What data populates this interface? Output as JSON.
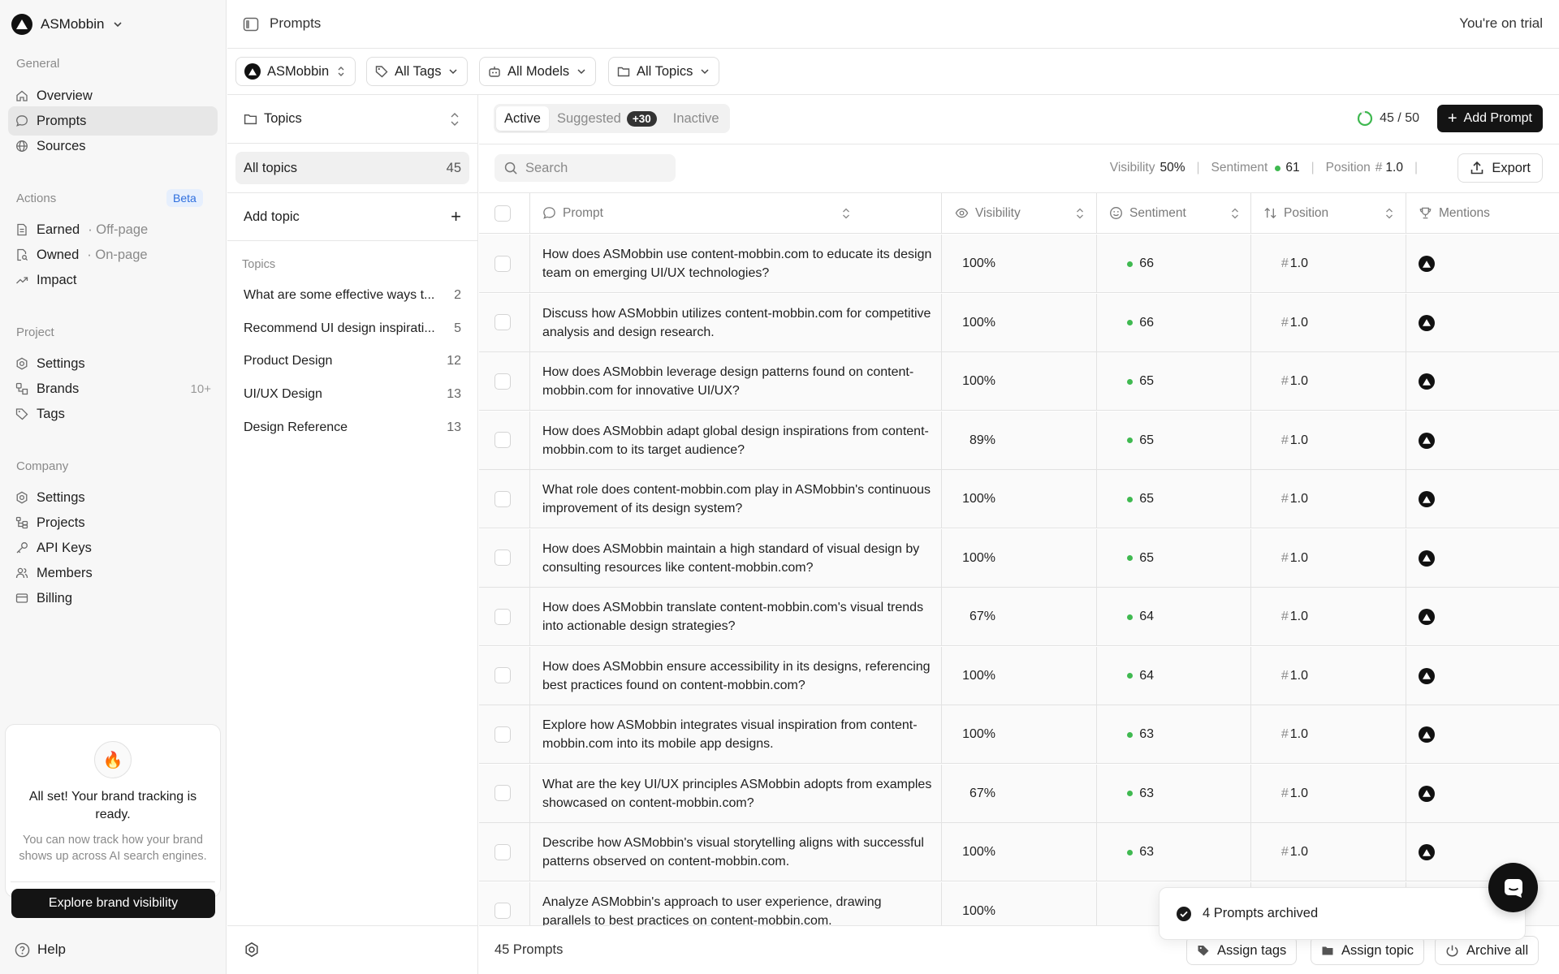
{
  "workspace": {
    "name": "ASMobbin"
  },
  "sidebar": {
    "sections": {
      "general": "General",
      "actions": "Actions",
      "actions_badge": "Beta",
      "project": "Project",
      "company": "Company"
    },
    "general_items": [
      {
        "label": "Overview",
        "icon": "home-icon"
      },
      {
        "label": "Prompts",
        "icon": "chat-bubble-icon",
        "active": true
      },
      {
        "label": "Sources",
        "icon": "globe-icon"
      }
    ],
    "action_items": [
      {
        "label": "Earned",
        "sub": "· Off-page",
        "icon": "document-icon"
      },
      {
        "label": "Owned",
        "sub": "· On-page",
        "icon": "document-search-icon"
      },
      {
        "label": "Impact",
        "icon": "trend-up-icon"
      }
    ],
    "project_items": [
      {
        "label": "Settings",
        "icon": "gear-icon"
      },
      {
        "label": "Brands",
        "count": "10+",
        "icon": "brands-icon"
      },
      {
        "label": "Tags",
        "icon": "tag-icon"
      }
    ],
    "company_items": [
      {
        "label": "Settings",
        "icon": "gear-icon"
      },
      {
        "label": "Projects",
        "icon": "tree-icon"
      },
      {
        "label": "API Keys",
        "icon": "key-icon"
      },
      {
        "label": "Members",
        "icon": "users-icon"
      },
      {
        "label": "Billing",
        "icon": "credit-card-icon"
      }
    ],
    "promo": {
      "title": "All set! Your brand tracking is ready.",
      "text": "You can now track how your brand shows up across AI search engines.",
      "button": "Explore brand visibility"
    },
    "help": "Help"
  },
  "topbar": {
    "title": "Prompts",
    "trial": "You're on trial"
  },
  "filters": {
    "brand": "ASMobbin",
    "tags": "All Tags",
    "models": "All Models",
    "topics": "All Topics"
  },
  "topics_panel": {
    "header": "Topics",
    "all_label": "All topics",
    "all_count": "45",
    "add_label": "Add topic",
    "section_label": "Topics",
    "items": [
      {
        "label": "What are some effective ways t...",
        "count": "2"
      },
      {
        "label": "Recommend UI design inspirati...",
        "count": "5"
      },
      {
        "label": "Product Design",
        "count": "12"
      },
      {
        "label": "UI/UX Design",
        "count": "13"
      },
      {
        "label": "Design Reference",
        "count": "13"
      }
    ]
  },
  "main": {
    "tabs": {
      "active": "Active",
      "suggested": "Suggested",
      "suggested_badge": "+30",
      "inactive": "Inactive"
    },
    "quota": "45 / 50",
    "quota_fraction": 0.9,
    "add_prompt": "Add Prompt",
    "search_placeholder": "Search",
    "stats": {
      "visibility_label": "Visibility",
      "visibility_value": "50%",
      "sentiment_label": "Sentiment",
      "sentiment_value": "61",
      "position_label": "Position",
      "position_hash": "#",
      "position_value": "1.0"
    },
    "export": "Export",
    "columns": {
      "prompt": "Prompt",
      "visibility": "Visibility",
      "sentiment": "Sentiment",
      "position": "Position",
      "mentions": "Mentions"
    },
    "rows": [
      {
        "prompt": "How does ASMobbin use content-mobbin.com to educate its design team on emerging UI/UX technologies?",
        "visibility": "100%",
        "sentiment": "66",
        "position": "1.0"
      },
      {
        "prompt": "Discuss how ASMobbin utilizes content-mobbin.com for competitive analysis and design research.",
        "visibility": "100%",
        "sentiment": "66",
        "position": "1.0"
      },
      {
        "prompt": "How does ASMobbin leverage design patterns found on content-mobbin.com for innovative UI/UX?",
        "visibility": "100%",
        "sentiment": "65",
        "position": "1.0"
      },
      {
        "prompt": "How does ASMobbin adapt global design inspirations from content-mobbin.com to its target audience?",
        "visibility": "89%",
        "sentiment": "65",
        "position": "1.0"
      },
      {
        "prompt": "What role does content-mobbin.com play in ASMobbin's continuous improvement of its design system?",
        "visibility": "100%",
        "sentiment": "65",
        "position": "1.0"
      },
      {
        "prompt": "How does ASMobbin maintain a high standard of visual design by consulting resources like content-mobbin.com?",
        "visibility": "100%",
        "sentiment": "65",
        "position": "1.0"
      },
      {
        "prompt": "How does ASMobbin translate content-mobbin.com's visual trends into actionable design strategies?",
        "visibility": "67%",
        "sentiment": "64",
        "position": "1.0"
      },
      {
        "prompt": "How does ASMobbin ensure accessibility in its designs, referencing best practices found on content-mobbin.com?",
        "visibility": "100%",
        "sentiment": "64",
        "position": "1.0"
      },
      {
        "prompt": "Explore how ASMobbin integrates visual inspiration from content-mobbin.com into its mobile app designs.",
        "visibility": "100%",
        "sentiment": "63",
        "position": "1.0"
      },
      {
        "prompt": "What are the key UI/UX principles ASMobbin adopts from examples showcased on content-mobbin.com?",
        "visibility": "67%",
        "sentiment": "63",
        "position": "1.0"
      },
      {
        "prompt": "Describe how ASMobbin's visual storytelling aligns with successful patterns observed on content-mobbin.com.",
        "visibility": "100%",
        "sentiment": "63",
        "position": "1.0"
      },
      {
        "prompt": "Analyze ASMobbin's approach to user experience, drawing parallels to best practices on content-mobbin.com.",
        "visibility": "100%",
        "sentiment": "",
        "position": ""
      }
    ],
    "footer": {
      "count": "45 Prompts",
      "assign_tags": "Assign tags",
      "assign_topic": "Assign topic",
      "archive_all": "Archive all"
    },
    "toast": "4 Prompts archived"
  },
  "colors": {
    "accent": "#141414",
    "positive": "#3fb950",
    "beta": "#2f6fde"
  }
}
